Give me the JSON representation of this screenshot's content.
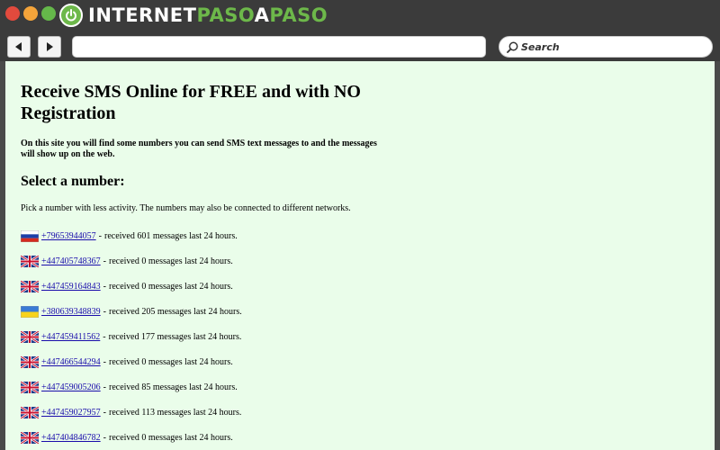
{
  "window": {
    "logo_part1": "INTERNET",
    "logo_part2": "PASO",
    "logo_part3": "A",
    "logo_part4": "PASO"
  },
  "toolbar": {
    "back_icon": "back-arrow-icon",
    "forward_icon": "forward-arrow-icon",
    "address_value": "",
    "search_placeholder": "Search"
  },
  "page": {
    "title": "Receive SMS Online for FREE and with NO Registration",
    "intro": "On this site you will find some numbers you can send SMS text messages to and the messages will show up on the web.",
    "section_heading": "Select a number:",
    "pick_text": "Pick a number with less activity. The numbers may also be connected to different networks.",
    "separator": "-",
    "numbers": [
      {
        "flag": "ru",
        "number": "+79653944057",
        "activity": "received 601 messages last 24 hours."
      },
      {
        "flag": "uk",
        "number": "+447405748367",
        "activity": "received 0 messages last 24 hours."
      },
      {
        "flag": "uk",
        "number": "+447459164843",
        "activity": "received 0 messages last 24 hours."
      },
      {
        "flag": "ua",
        "number": "+380639348839",
        "activity": "received 205 messages last 24 hours."
      },
      {
        "flag": "uk",
        "number": "+447459411562",
        "activity": "received 177 messages last 24 hours."
      },
      {
        "flag": "uk",
        "number": "+447466544294",
        "activity": "received 0 messages last 24 hours."
      },
      {
        "flag": "uk",
        "number": "+447459005206",
        "activity": "received 85 messages last 24 hours."
      },
      {
        "flag": "uk",
        "number": "+447459027957",
        "activity": "received 113 messages last 24 hours."
      },
      {
        "flag": "uk",
        "number": "+447404846782",
        "activity": "received 0 messages last 24 hours."
      }
    ]
  },
  "colors": {
    "content_bg": "#eafdea",
    "link": "#1a0dab",
    "logo_green": "#6db84a"
  }
}
